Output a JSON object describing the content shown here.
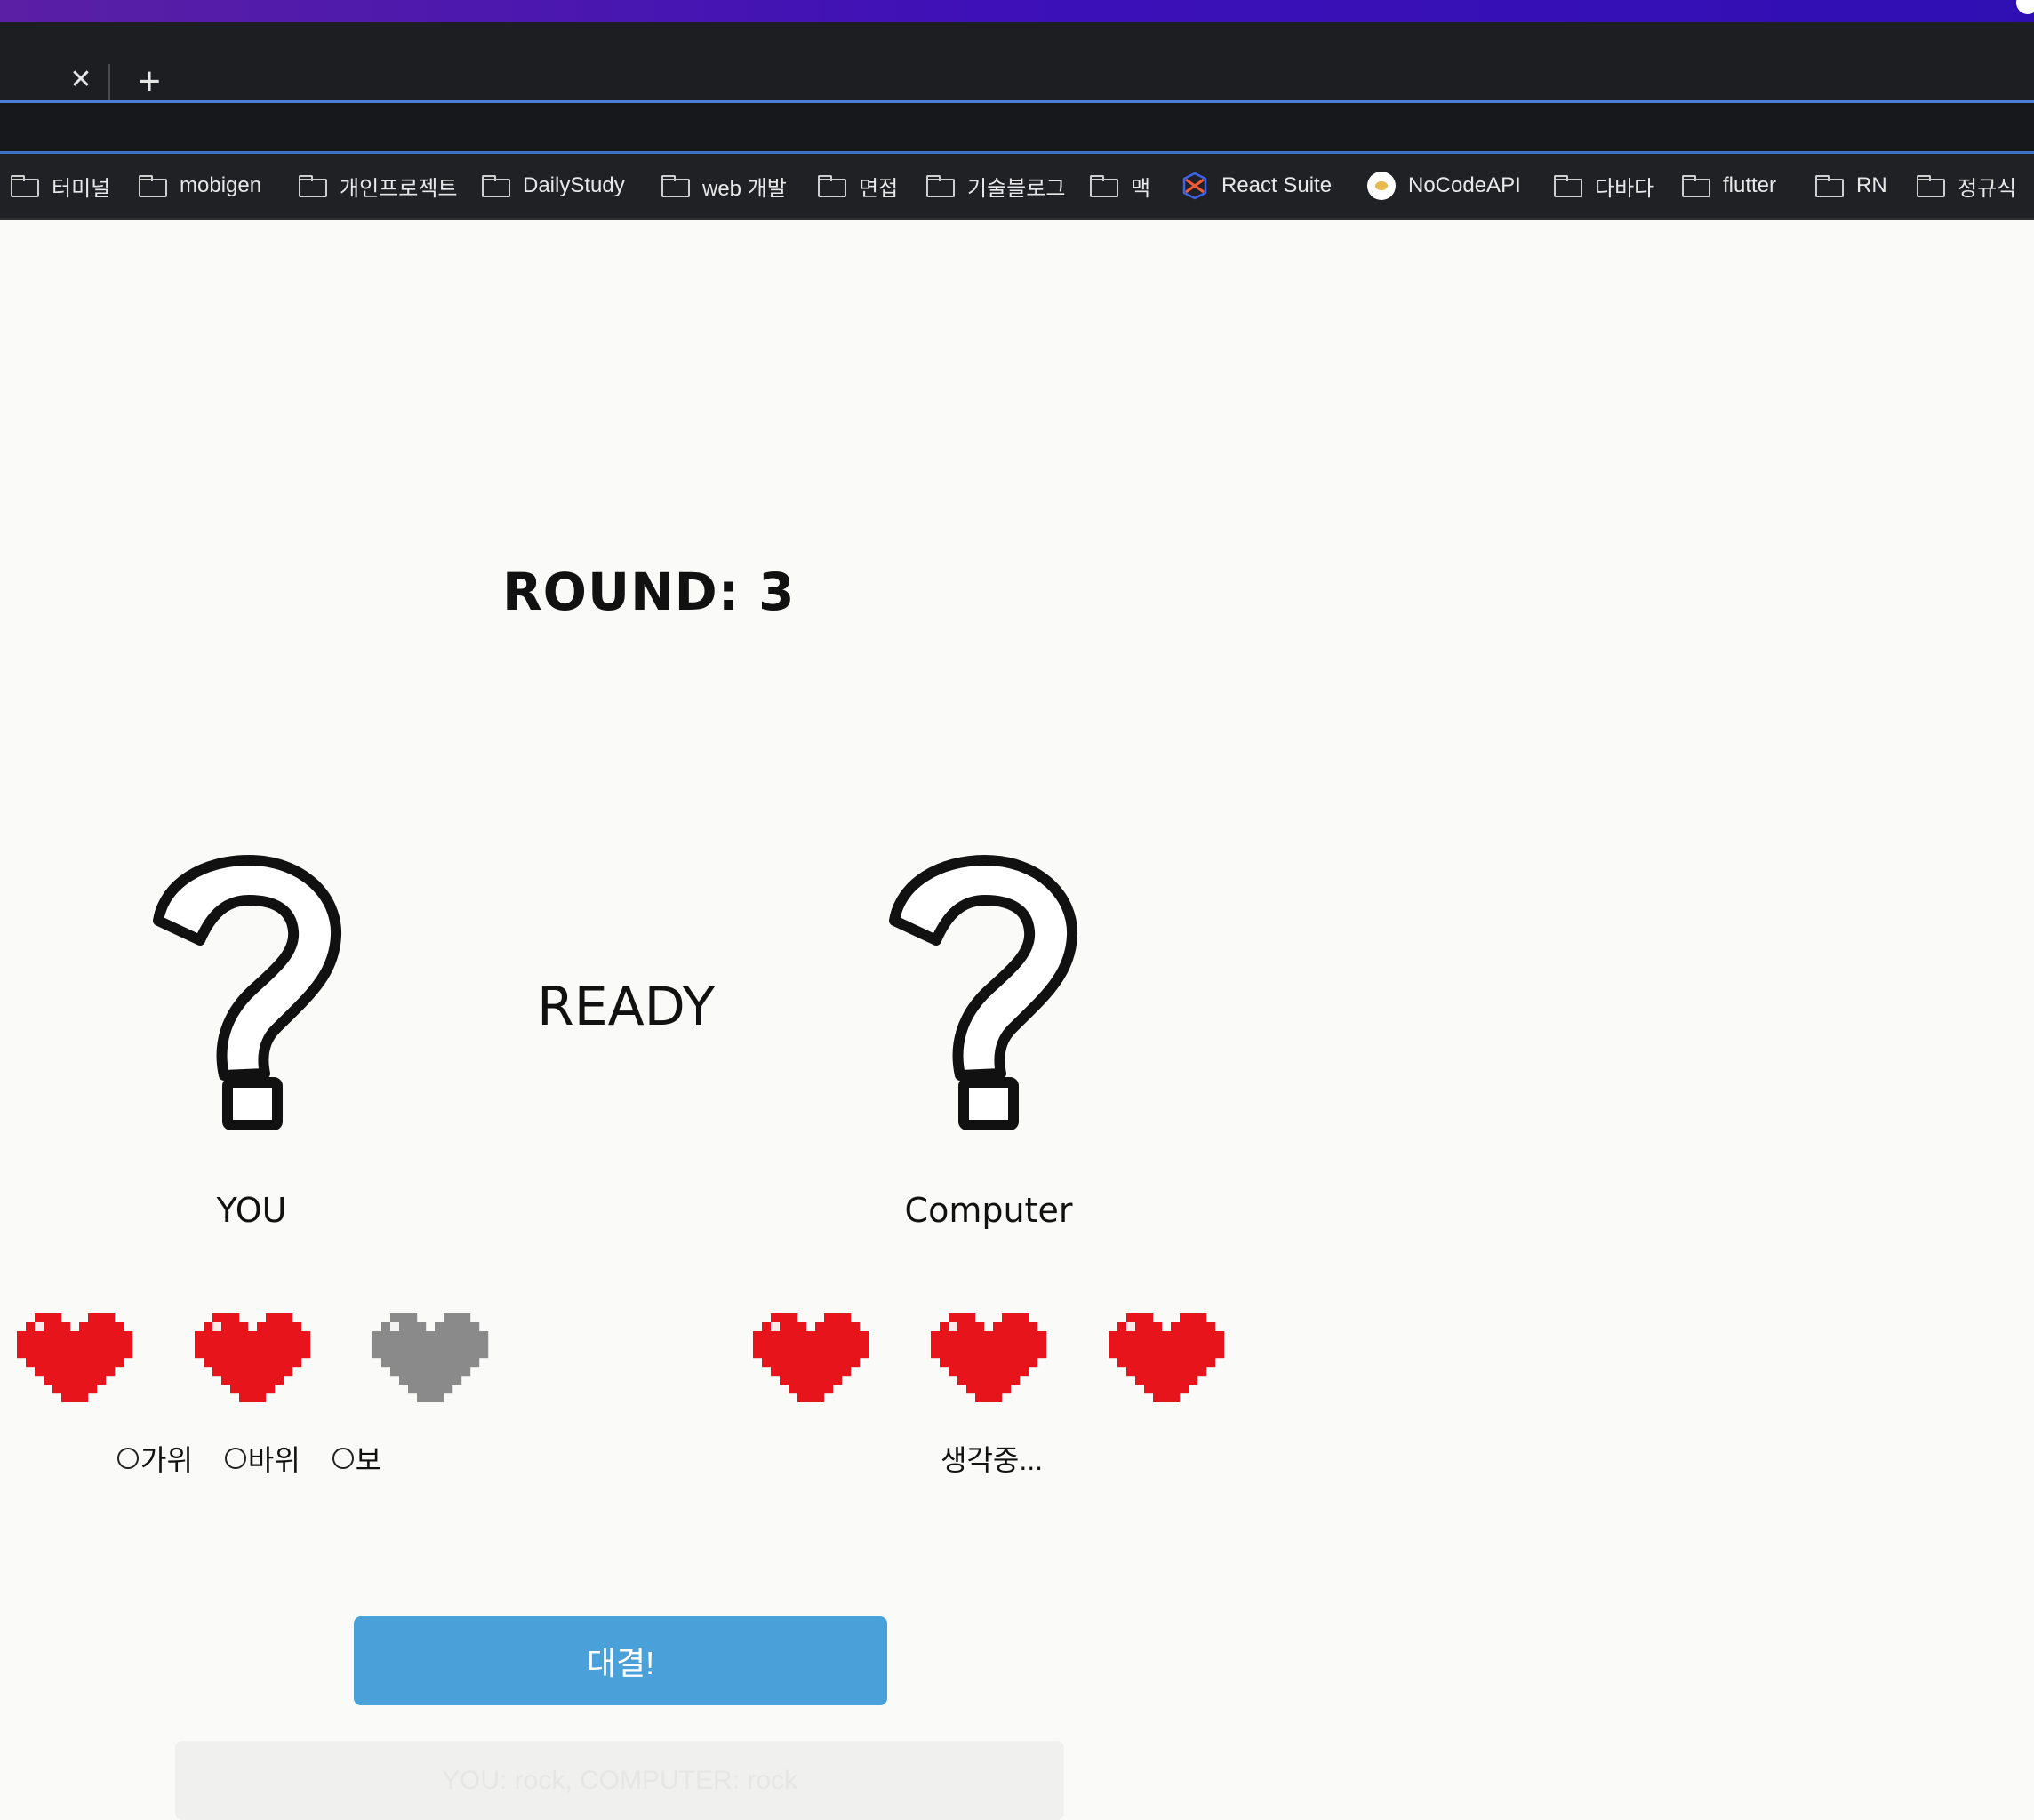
{
  "browser": {
    "tab_close_icon": "close-icon",
    "new_tab_icon": "plus-icon",
    "bookmarks": [
      {
        "label": "터미널",
        "icon": "folder-icon"
      },
      {
        "label": "mobigen",
        "icon": "folder-icon"
      },
      {
        "label": "개인프로젝트",
        "icon": "folder-icon"
      },
      {
        "label": "DailyStudy",
        "icon": "folder-icon"
      },
      {
        "label": "web 개발",
        "icon": "folder-icon"
      },
      {
        "label": "면접",
        "icon": "folder-icon"
      },
      {
        "label": "기술블로그",
        "icon": "folder-icon"
      },
      {
        "label": "맥",
        "icon": "folder-icon"
      },
      {
        "label": "React Suite",
        "icon": "react-suite-icon"
      },
      {
        "label": "NoCodeAPI",
        "icon": "nocodeapi-icon"
      },
      {
        "label": "다바다",
        "icon": "folder-icon"
      },
      {
        "label": "flutter",
        "icon": "folder-icon"
      },
      {
        "label": "RN",
        "icon": "folder-icon"
      },
      {
        "label": "정규식",
        "icon": "folder-icon"
      }
    ]
  },
  "game": {
    "round_text": "ROUND: 3",
    "status_text": "READY",
    "player": {
      "name": "YOU",
      "hearts": [
        "full",
        "full",
        "empty"
      ],
      "choices": [
        "가위",
        "바위",
        "보"
      ]
    },
    "computer": {
      "name": "Computer",
      "hearts": [
        "full",
        "full",
        "full"
      ],
      "thinking_text": "생각중..."
    },
    "fight_button": "대결!",
    "result_text": "YOU: rock, COMPUTER: rock",
    "colors": {
      "heart_full": "#e8141c",
      "heart_empty": "#8a8a8a",
      "button": "#4aa0d8"
    }
  }
}
